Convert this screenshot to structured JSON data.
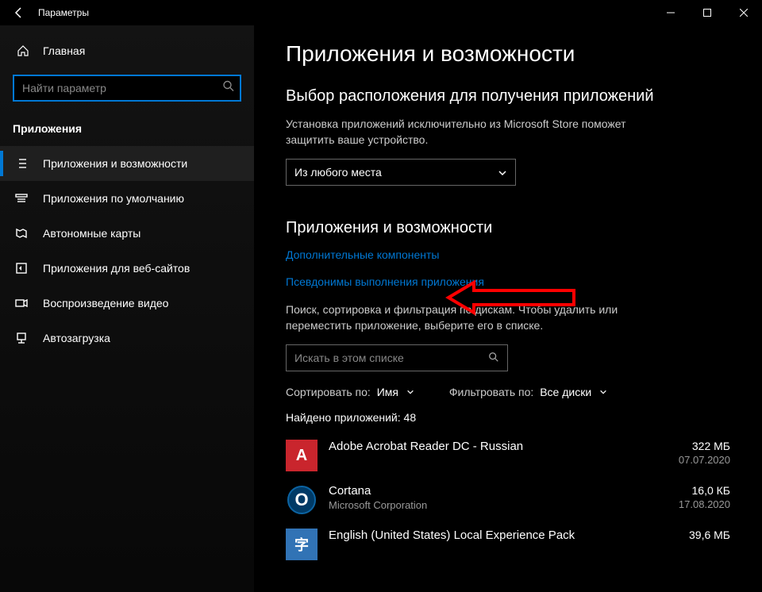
{
  "window": {
    "title": "Параметры"
  },
  "home": {
    "label": "Главная"
  },
  "search": {
    "placeholder": "Найти параметр"
  },
  "section": {
    "label": "Приложения"
  },
  "nav": {
    "items": [
      {
        "label": "Приложения и возможности"
      },
      {
        "label": "Приложения по умолчанию"
      },
      {
        "label": "Автономные карты"
      },
      {
        "label": "Приложения для веб-сайтов"
      },
      {
        "label": "Воспроизведение видео"
      },
      {
        "label": "Автозагрузка"
      }
    ]
  },
  "main": {
    "title": "Приложения и возможности",
    "choose_heading": "Выбор расположения для получения приложений",
    "choose_desc": "Установка приложений исключительно из Microsoft Store поможет защитить ваше устройство.",
    "choose_value": "Из любого места",
    "section2_heading": "Приложения и возможности",
    "link_optional": "Дополнительные компоненты",
    "link_aliases": "Псевдонимы выполнения приложения",
    "filter_desc": "Поиск, сортировка и фильтрация по дискам. Чтобы удалить или переместить приложение, выберите его в списке.",
    "listsearch_placeholder": "Искать в этом списке",
    "sort_label": "Сортировать по:",
    "sort_value": "Имя",
    "filter_label": "Фильтровать по:",
    "filter_value": "Все диски",
    "found_label": "Найдено приложений:",
    "found_count": "48",
    "apps": [
      {
        "name": "Adobe Acrobat Reader DC - Russian",
        "publisher": "",
        "size": "322 МБ",
        "date": "07.07.2020",
        "glyph": "A",
        "iconClass": "red"
      },
      {
        "name": "Cortana",
        "publisher": "Microsoft Corporation",
        "size": "16,0 КБ",
        "date": "17.08.2020",
        "glyph": "O",
        "iconClass": "blue"
      },
      {
        "name": "English (United States) Local Experience Pack",
        "publisher": "",
        "size": "39,6 МБ",
        "date": "",
        "glyph": "字",
        "iconClass": "teal"
      }
    ]
  }
}
